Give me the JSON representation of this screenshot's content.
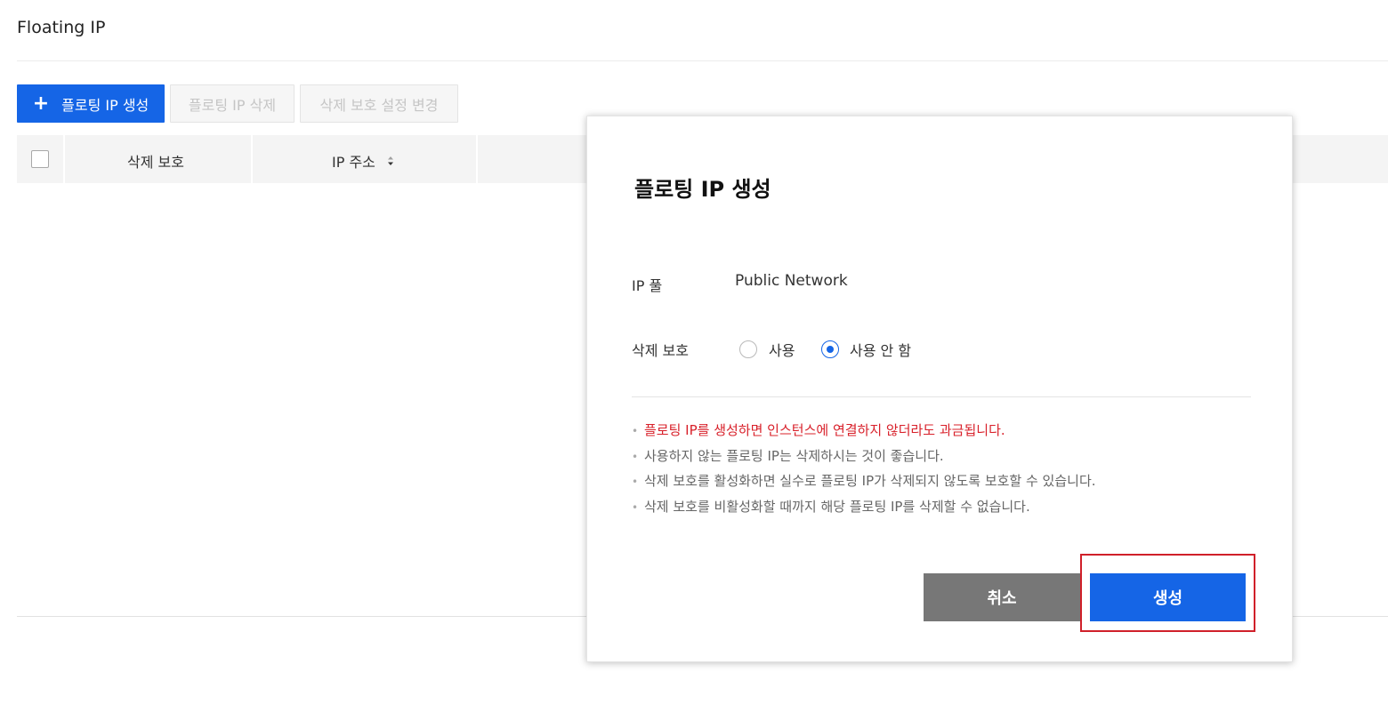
{
  "page": {
    "title": "Floating IP"
  },
  "toolbar": {
    "create_icon": "+",
    "create_label": "플로팅 IP 생성",
    "delete_label": "플로팅 IP 삭제",
    "protection_label": "삭제 보호 설정 변경"
  },
  "table": {
    "columns": [
      {
        "label": "삭제 보호"
      },
      {
        "label": "IP 주소",
        "sortable": true
      }
    ]
  },
  "modal": {
    "title": "플로팅 IP 생성",
    "ip_pool_label": "IP 풀",
    "ip_pool_value": "Public Network",
    "protection_label": "삭제 보호",
    "protection_options": [
      {
        "label": "사용",
        "selected": false
      },
      {
        "label": "사용 안 함",
        "selected": true
      }
    ],
    "notices": [
      "플로팅 IP를 생성하면 인스턴스에 연결하지 않더라도 과금됩니다.",
      "사용하지 않는 플로팅 IP는 삭제하시는 것이 좋습니다.",
      "삭제 보호를 활성화하면 실수로 플로팅 IP가 삭제되지 않도록 보호할 수 있습니다.",
      "삭제 보호를 비활성화할 때까지 해당 플로팅 IP를 삭제할 수 없습니다."
    ],
    "cancel_label": "취소",
    "create_label": "생성"
  },
  "colors": {
    "primary": "#1565e6",
    "warning_text": "#d8202a",
    "cancel_button": "#777777",
    "highlight": "#d0202a"
  },
  "icons": [
    "plus-icon",
    "sort-icon",
    "radio-icon"
  ]
}
